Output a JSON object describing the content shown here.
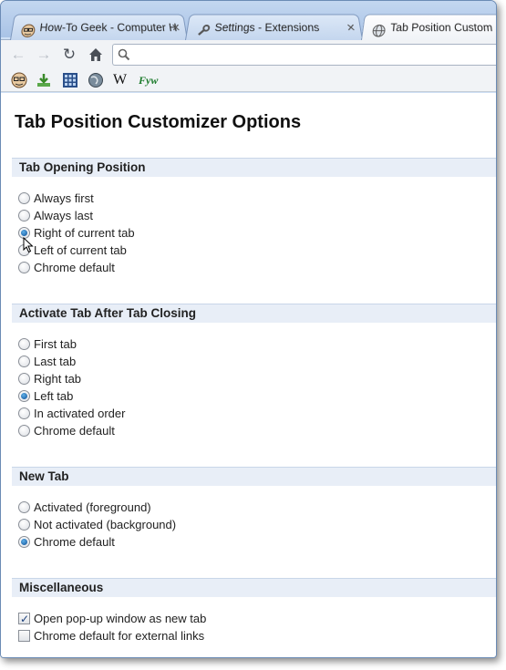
{
  "tabs": [
    {
      "title": "How-To Geek - Computer H",
      "icon": "howtogeek-icon",
      "active": false
    },
    {
      "title": "Settings - Extensions",
      "icon": "wrench-icon",
      "active": false
    },
    {
      "title": "Tab Position Custom",
      "icon": "globe-icon",
      "active": true
    }
  ],
  "toolbar": {
    "back_icon": "back-arrow-icon",
    "forward_icon": "forward-arrow-icon",
    "reload_icon": "reload-icon",
    "home_icon": "home-icon",
    "omnibox_value": ""
  },
  "bookmarks": [
    {
      "icon": "howtogeek-icon"
    },
    {
      "icon": "download-icon"
    },
    {
      "icon": "grid-icon"
    },
    {
      "icon": "globe-icon"
    },
    {
      "icon": "wikipedia-icon",
      "text": "W"
    },
    {
      "icon": "fyw-icon",
      "text": "Fyw"
    }
  ],
  "page": {
    "title": "Tab Position Customizer Options",
    "sections": [
      {
        "header": "Tab Opening Position",
        "type": "radio",
        "options": [
          {
            "label": "Always first",
            "checked": false
          },
          {
            "label": "Always last",
            "checked": false
          },
          {
            "label": "Right of current tab",
            "checked": true
          },
          {
            "label": "Left of current tab",
            "checked": false
          },
          {
            "label": "Chrome default",
            "checked": false
          }
        ]
      },
      {
        "header": "Activate Tab After Tab Closing",
        "type": "radio",
        "options": [
          {
            "label": "First tab",
            "checked": false
          },
          {
            "label": "Last tab",
            "checked": false
          },
          {
            "label": "Right tab",
            "checked": false
          },
          {
            "label": "Left tab",
            "checked": true
          },
          {
            "label": "In activated order",
            "checked": false
          },
          {
            "label": "Chrome default",
            "checked": false
          }
        ]
      },
      {
        "header": "New Tab",
        "type": "radio",
        "options": [
          {
            "label": "Activated (foreground)",
            "checked": false
          },
          {
            "label": "Not activated (background)",
            "checked": false
          },
          {
            "label": "Chrome default",
            "checked": true
          }
        ]
      },
      {
        "header": "Miscellaneous",
        "type": "checkbox",
        "options": [
          {
            "label": "Open pop-up window as new tab",
            "checked": true
          },
          {
            "label": "Chrome default for external links",
            "checked": false
          }
        ]
      }
    ]
  },
  "colors": {
    "frame": "#cfe0f5",
    "section_header_bg": "#e8eef7",
    "radio_fill": "#0e4f96"
  }
}
